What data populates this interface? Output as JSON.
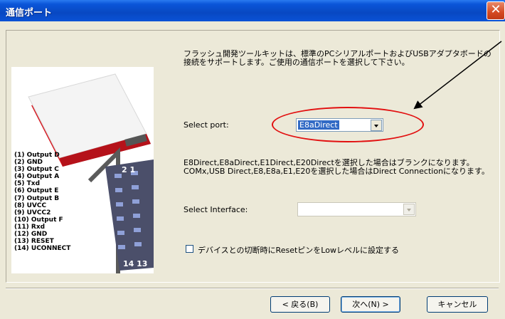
{
  "window": {
    "title": "通信ポート",
    "close_glyph": "✕"
  },
  "description": "フラッシュ開発ツールキットは、標準のPCシリアルポートおよびUSBアダプタボードの接続をサポートします。ご使用の通信ポートを選択して下さい。",
  "device_image": {
    "pins": [
      "(1) Output D",
      "(2) GND",
      "(3) Output C",
      "(4) Output A",
      "(5) Txd",
      "(6) Output E",
      "(7) Output B",
      "(8) UVCC",
      "(9) UVCC2",
      "(10) Output F",
      "(11) Rxd",
      "(12) GND",
      "(13) RESET",
      "(14) UCONNECT"
    ],
    "connector_top": "2 1",
    "connector_bottom": "14 13"
  },
  "port": {
    "label": "Select port:",
    "value": "E8aDirect"
  },
  "hint": "E8Direct,E8aDirect,E1Direct,E20Directを選択した場合はブランクになります。COMx,USB Direct,E8,E8a,E1,E20を選択した場合はDirect Connectionになります。",
  "interface": {
    "label": "Select Interface:",
    "value": ""
  },
  "reset_checkbox": {
    "label": "デバイスとの切断時にResetピンをLowレベルに設定する",
    "checked": false
  },
  "buttons": {
    "back": "< 戻る(B)",
    "next": "次へ(N) >",
    "cancel": "キャンセル"
  },
  "annotation_color": "#e21010"
}
